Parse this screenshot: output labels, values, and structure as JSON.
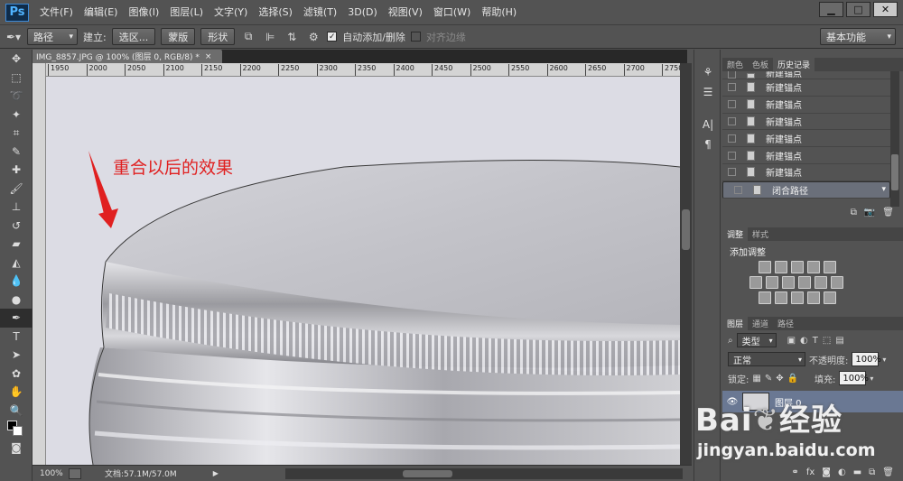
{
  "app": {
    "logo": "Ps"
  },
  "menu": [
    "文件(F)",
    "编辑(E)",
    "图像(I)",
    "图层(L)",
    "文字(Y)",
    "选择(S)",
    "滤镜(T)",
    "3D(D)",
    "视图(V)",
    "窗口(W)",
    "帮助(H)"
  ],
  "window_buttons": {
    "minimize": "▁",
    "restore": "□",
    "close": "✕"
  },
  "options": {
    "mode_select": "路径",
    "make_label": "建立:",
    "selection_btn": "选区...",
    "mask_btn": "蒙版",
    "shape_btn": "形状",
    "auto_add": "自动添加/删除",
    "align_edges": "对齐边缘",
    "workspace": "基本功能"
  },
  "document": {
    "tab_title": "IMG_8857.JPG @ 100% (图层 0, RGB/8) *",
    "ruler_ticks": [
      "1950",
      "2000",
      "2050",
      "2100",
      "2150",
      "2200",
      "2250",
      "2300",
      "2350",
      "2400",
      "2450",
      "2500",
      "2550",
      "2600",
      "2650",
      "2700",
      "2750"
    ],
    "annotation": "重合以后的效果",
    "zoom": "100%",
    "doc_info": "文档:57.1M/57.0M"
  },
  "history_panel": {
    "tabs": [
      "颜色",
      "色板",
      "历史记录"
    ],
    "items": [
      "新建锚点",
      "新建锚点",
      "新建锚点",
      "新建锚点",
      "新建锚点",
      "新建锚点",
      "新建锚点",
      "闭合路径"
    ]
  },
  "adjust_panel": {
    "tabs": [
      "调整",
      "样式"
    ],
    "title": "添加调整"
  },
  "layers_panel": {
    "tabs": [
      "图层",
      "通道",
      "路径"
    ],
    "filter": "类型",
    "blend": "正常",
    "opacity_label": "不透明度:",
    "opacity": "100%",
    "lock_label": "锁定:",
    "fill_label": "填充:",
    "fill": "100%",
    "layer_name": "图层 0"
  },
  "watermark": {
    "brand": "Bai",
    "brand2": "经验",
    "url": "jingyan.baidu.com"
  },
  "colors": {
    "ui_bg": "#535353",
    "canvas_bg": "#dadae2",
    "annotation_red": "#e02020",
    "selected_row": "#6a6f7a",
    "layer_sel": "#6a7893"
  }
}
